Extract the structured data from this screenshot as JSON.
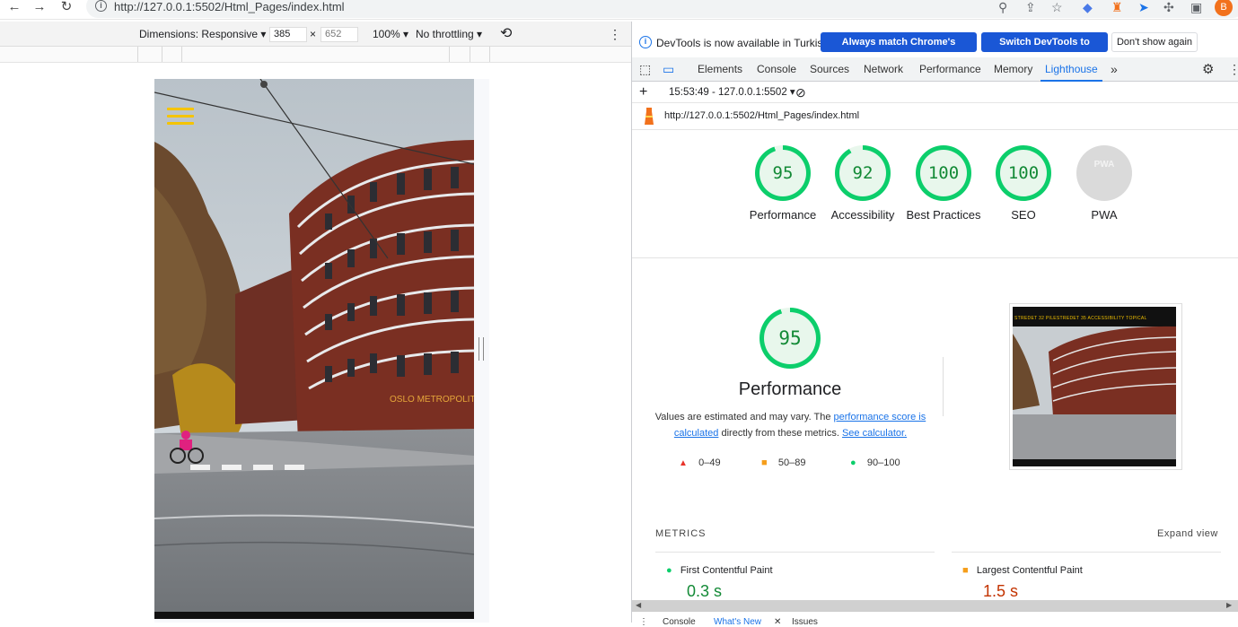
{
  "browser": {
    "url": "http://127.0.0.1:5502/Html_Pages/index.html",
    "avatar_letter": "B"
  },
  "device_toolbar": {
    "dimensions_label": "Dimensions: Responsive",
    "width": "385",
    "height_value": "652",
    "times": "×",
    "zoom": "100%",
    "throttling": "No throttling"
  },
  "devtools": {
    "infobar": {
      "message": "DevTools is now available in Turkish!",
      "btn_always": "Always match Chrome's language",
      "btn_switch": "Switch DevTools to Turkish",
      "btn_dont": "Don't show again"
    },
    "tabs": [
      "Elements",
      "Console",
      "Sources",
      "Network",
      "Performance",
      "Memory",
      "Lighthouse"
    ],
    "active_tab": "Lighthouse",
    "report_selector": "15:53:49 - 127.0.0.1:5502",
    "report_url": "http://127.0.0.1:5502/Html_Pages/index.html"
  },
  "scores": [
    {
      "value": "95",
      "label": "Performance",
      "score": 0.95
    },
    {
      "value": "92",
      "label": "Accessibility",
      "score": 0.92
    },
    {
      "value": "100",
      "label": "Best Practices",
      "score": 1.0
    },
    {
      "value": "100",
      "label": "SEO",
      "score": 1.0
    },
    {
      "value": "PWA",
      "label": "PWA",
      "score": null
    }
  ],
  "performance": {
    "score": "95",
    "title": "Performance",
    "desc_prefix": "Values are estimated and may vary. The ",
    "link1": "performance score is calculated",
    "desc_mid": " directly from these metrics. ",
    "link2": "See calculator.",
    "legend": [
      {
        "range": "0–49",
        "color": "#e8332a"
      },
      {
        "range": "50–89",
        "color": "#f59e1b"
      },
      {
        "range": "90–100",
        "color": "#0cce6b"
      }
    ]
  },
  "thumbnail": {
    "nav_text": "STREDET 32    PILESTREDET 35    ACCESSIBILITY    TOPICAL"
  },
  "metrics": {
    "label": "METRICS",
    "expand": "Expand view",
    "items": [
      {
        "name": "First Contentful Paint",
        "value": "0.3 s",
        "color": "#0cce6b",
        "value_color": "#138a36"
      },
      {
        "name": "Largest Contentful Paint",
        "value": "1.5 s",
        "color": "#f59e1b",
        "value_color": "#c33300"
      }
    ]
  },
  "photo": {
    "building_sign": "OSLO METROPOLIT"
  },
  "bottom_drawer": {
    "tabs": [
      "Console",
      "What's New",
      "Issues"
    ]
  }
}
